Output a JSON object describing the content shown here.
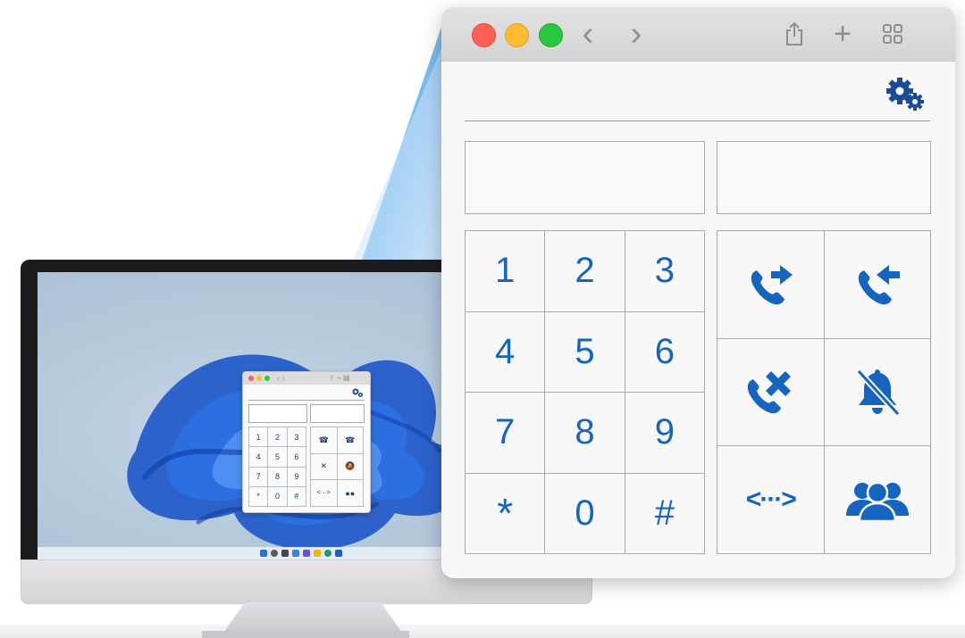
{
  "colors": {
    "accent": "#1565c0",
    "close": "#ff5f57",
    "minimize": "#febc2e",
    "maximize": "#28c840",
    "titlebar": "#d9d9d9",
    "window_bg": "#f7f7f7",
    "beam": "#6ab2ee"
  },
  "browser": {
    "traffic_lights": [
      "close-button",
      "minimize-button",
      "maximize-button"
    ],
    "back_icon": "chevron-left-icon",
    "forward_icon": "chevron-right-icon",
    "share_icon": "share-icon",
    "new_tab_icon": "plus-icon",
    "tabs_overview_icon": "grid-icon",
    "back_glyph": "‹",
    "forward_glyph": "›",
    "plus_glyph": "+"
  },
  "phone": {
    "settings_icon": "gears-icon",
    "number_field_value": "",
    "status_field_value": "",
    "keypad": [
      "1",
      "2",
      "3",
      "4",
      "5",
      "6",
      "7",
      "8",
      "9",
      "*",
      "0",
      "#"
    ],
    "actions": [
      {
        "name": "call-transfer-out-button",
        "icon": "phone-arrow-right-icon"
      },
      {
        "name": "call-incoming-button",
        "icon": "phone-arrow-left-icon"
      },
      {
        "name": "hang-up-button",
        "icon": "phone-x-icon"
      },
      {
        "name": "mute-ringer-button",
        "icon": "bell-slash-icon"
      },
      {
        "name": "transfer-button",
        "icon": "arrows-left-right-icon",
        "glyph": "<···>"
      },
      {
        "name": "conference-button",
        "icon": "users-icon"
      }
    ]
  },
  "mini_window": {
    "keypad": [
      "1",
      "2",
      "3",
      "4",
      "5",
      "6",
      "7",
      "8",
      "9",
      "*",
      "0",
      "#"
    ],
    "transfer_glyph": "<···>"
  },
  "desktop": {
    "wallpaper": "windows-bloom-wallpaper",
    "taskbar_icons": [
      "start-icon",
      "search-icon",
      "widgets-icon",
      "task-view-icon",
      "chat-icon",
      "folder-icon",
      "edge-icon",
      "store-icon"
    ]
  }
}
